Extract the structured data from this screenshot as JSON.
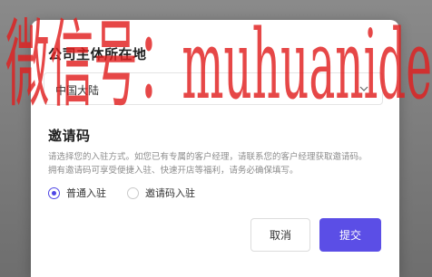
{
  "company_location": {
    "title": "公司主体所在地",
    "selected": "中国大陆"
  },
  "invite": {
    "title": "邀请码",
    "description": "请选择您的入驻方式。如您已有专属的客户经理，请联系您的客户经理获取邀请码。拥有邀请码可享受便捷入驻、快速开店等福利，请务必确保填写。",
    "options": [
      {
        "label": "普通入驻",
        "checked": true
      },
      {
        "label": "邀请码入驻",
        "checked": false
      }
    ]
  },
  "actions": {
    "cancel_label": "取消",
    "submit_label": "提交"
  },
  "watermark": {
    "text": "微信号：muhuanide"
  },
  "colors": {
    "accent": "#5b4ee6",
    "watermark": "#e01e1e"
  }
}
